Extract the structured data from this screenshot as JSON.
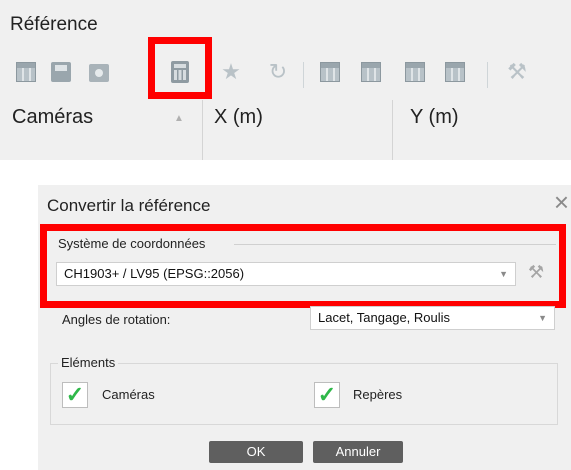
{
  "panel": {
    "title": "Référence",
    "columns": [
      "Caméras",
      "X (m)",
      "Y (m)"
    ]
  },
  "dialog": {
    "title": "Convertir la référence",
    "close_glyph": "×",
    "coord_group_label": "Système de coordonnées",
    "coord_system_value": "CH1903+ / LV95 (EPSG::2056)",
    "rotation_label": "Angles de rotation:",
    "rotation_value": "Lacet, Tangage, Roulis",
    "elements_label": "Eléments",
    "cameras_label": "Caméras",
    "markers_label": "Repères",
    "ok_label": "OK",
    "cancel_label": "Annuler"
  },
  "icons": {
    "star": "★",
    "refresh": "↻",
    "tools": "⚒",
    "check": "✓"
  },
  "colors": {
    "highlight": "#ff0000",
    "check": "#2fb84a",
    "button": "#5f5f5f"
  }
}
